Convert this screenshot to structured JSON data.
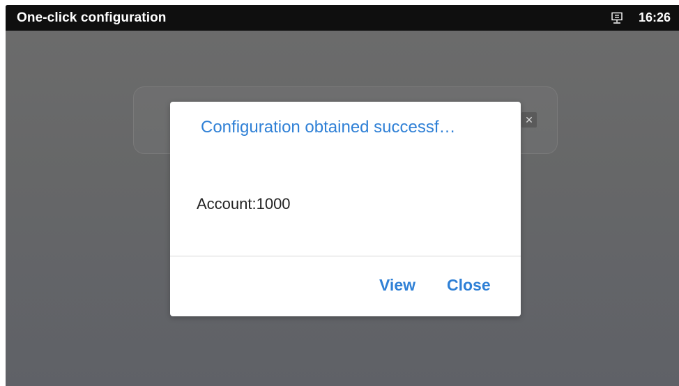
{
  "status_bar": {
    "app_title": "One-click configuration",
    "network_icon": "ethernet-icon",
    "time": "16:26"
  },
  "background": {
    "clear_icon_glyph": "✕"
  },
  "dialog": {
    "title": "Configuration obtained successf…",
    "message": "Account:1000",
    "buttons": {
      "view_label": "View",
      "close_label": "Close"
    }
  },
  "colors": {
    "accent": "#2f80d6",
    "status_bar": "#0f0f0f",
    "overlay": "#666768"
  }
}
